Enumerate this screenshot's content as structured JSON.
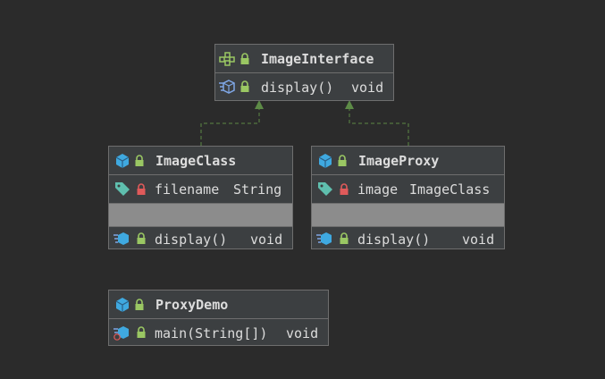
{
  "interface": {
    "name": "ImageInterface",
    "method": "display()",
    "method_type": "void"
  },
  "image_class": {
    "name": "ImageClass",
    "field": "filename",
    "field_type": "String",
    "method": "display()",
    "method_type": "void"
  },
  "image_proxy": {
    "name": "ImageProxy",
    "field": "image",
    "field_type": "ImageClass",
    "method": "display()",
    "method_type": "void"
  },
  "proxy_demo": {
    "name": "ProxyDemo",
    "method": "main(String[])",
    "method_type": "void"
  },
  "colors": {
    "background": "#2b2b2b",
    "box": "#3c3f41",
    "arrow": "#5d8a46",
    "class_icon": "#3fa9e0",
    "lock_public": "#9ac763",
    "lock_private": "#e05a5a",
    "field_tag": "#5fbfae"
  }
}
